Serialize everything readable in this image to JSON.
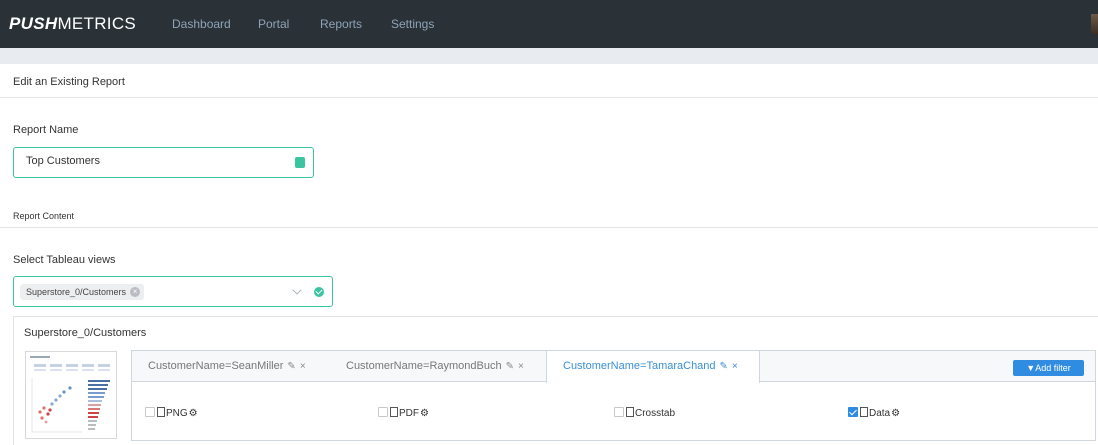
{
  "app": {
    "logo_bold": "PUSH",
    "logo_light": "METRICS",
    "nav": [
      "Dashboard",
      "Portal",
      "Reports",
      "Settings"
    ]
  },
  "page": {
    "heading": "Edit an Existing Report"
  },
  "form": {
    "report_name_label": "Report Name",
    "report_name_value": "Top Customers",
    "report_content_label": "Report Content",
    "select_views_label": "Select Tableau views",
    "selected_view_chip": "Superstore_0/Customers"
  },
  "view": {
    "title": "Superstore_0/Customers",
    "filter_tabs": [
      "CustomerName=SeanMiller",
      "CustomerName=RaymondBuch",
      "CustomerName=TamaraChand"
    ],
    "active_tab_index": 2,
    "add_filter_label": "Add filter",
    "options": [
      {
        "label": "PNG",
        "checked": false
      },
      {
        "label": "PDF",
        "checked": false
      },
      {
        "label": "Crosstab",
        "checked": false
      },
      {
        "label": "Data",
        "checked": true
      }
    ]
  },
  "colors": {
    "nav_bg": "#2a3238",
    "accent_green": "#3ac5a0",
    "accent_blue": "#2f8ce0"
  }
}
